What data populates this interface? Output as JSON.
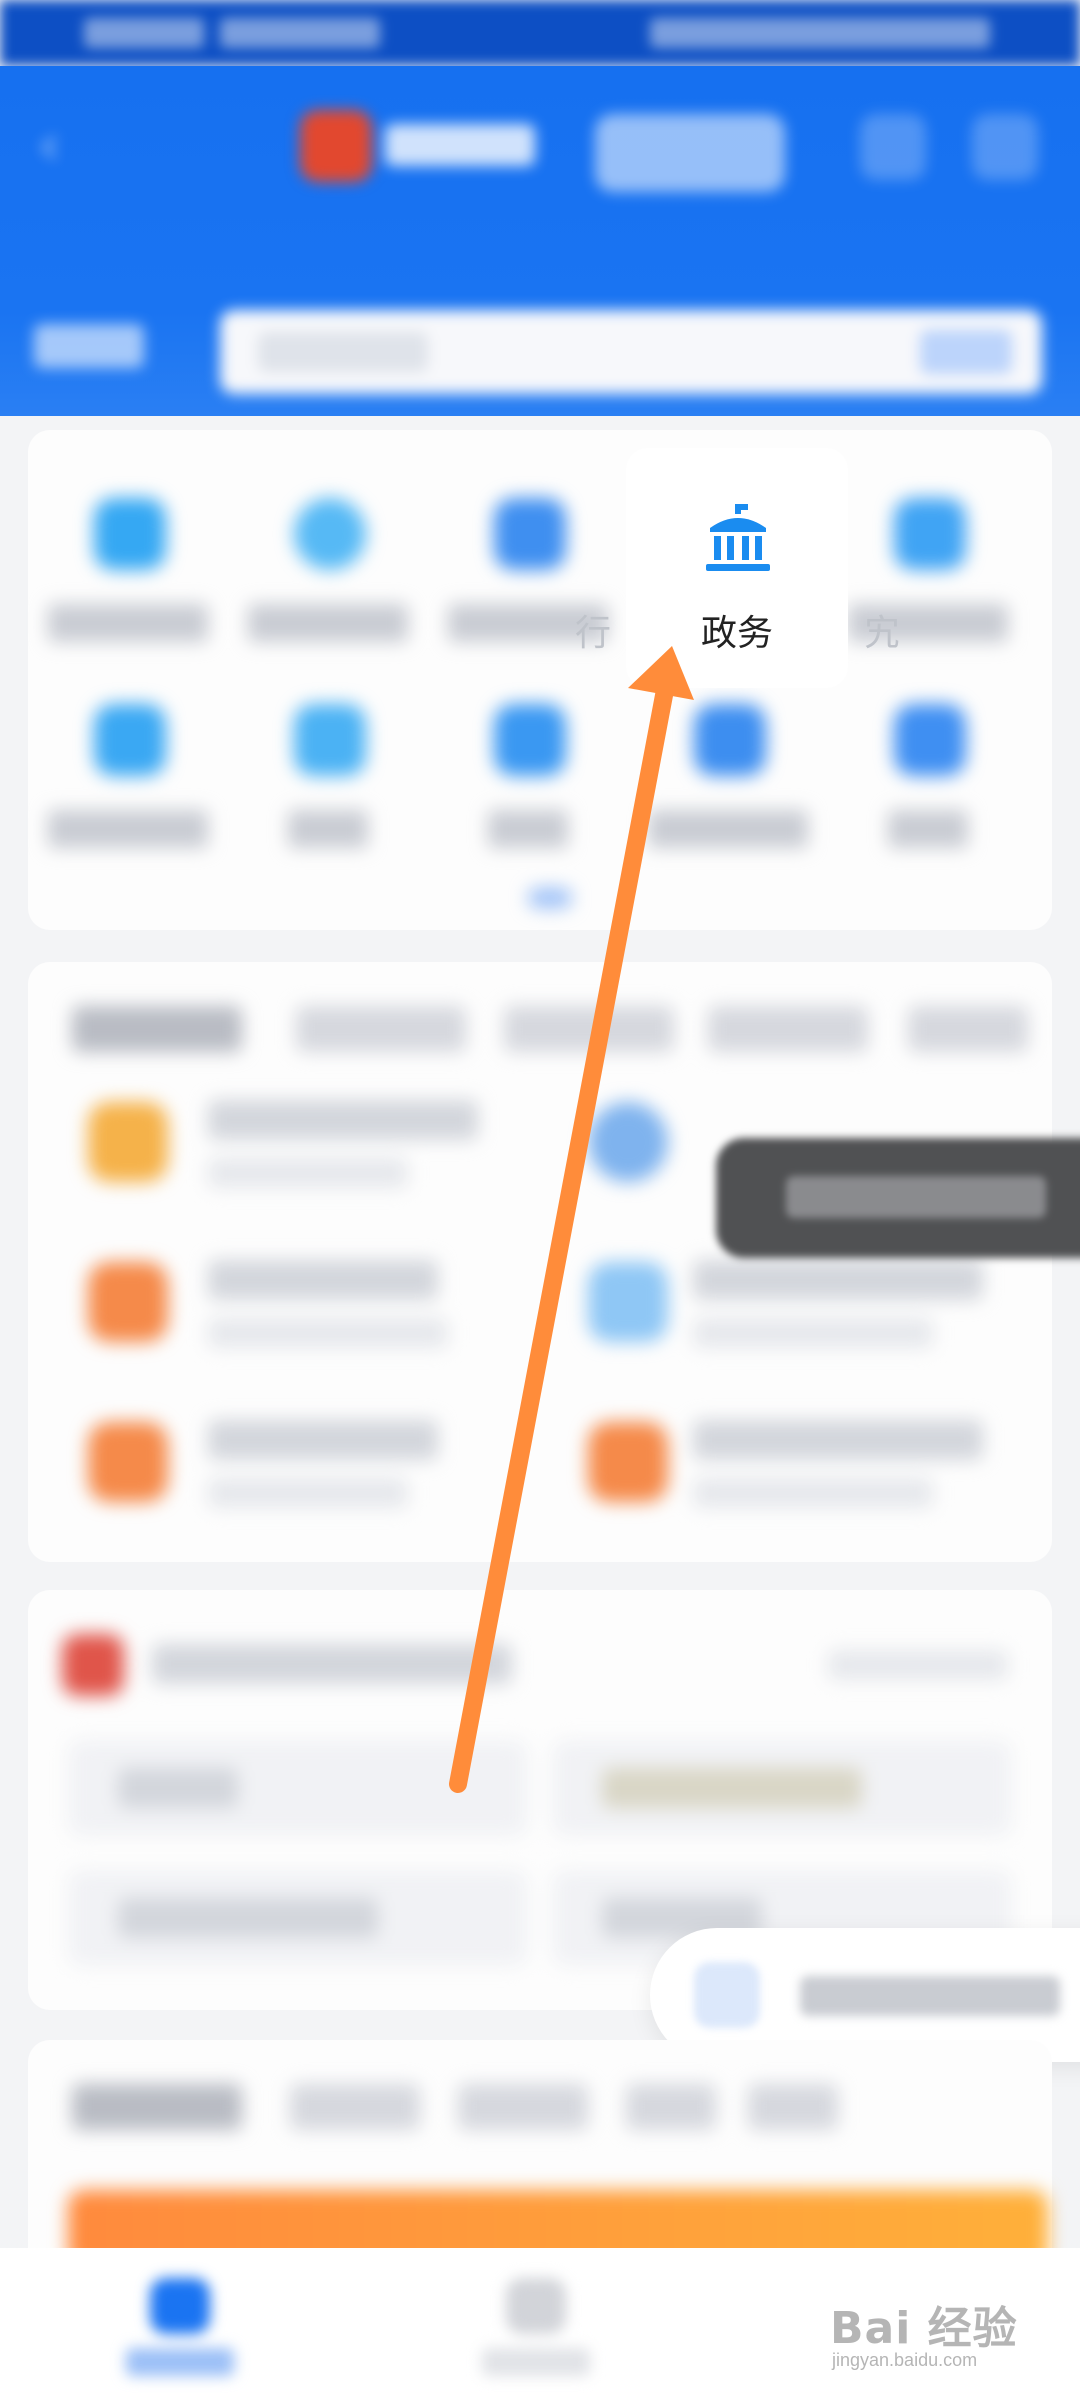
{
  "services": {
    "highlighted_label": "政务",
    "partial_left_label": "行",
    "partial_right_label": "宄"
  },
  "watermark": {
    "brand": "Bai 经验",
    "sub": "jingyan.baidu.com"
  },
  "colors": {
    "primary_blue": "#1a74f2",
    "annotation_arrow": "#ff8c3a",
    "gov_icon": "#1a8cf0"
  },
  "icons": {
    "gov": "government-building-icon",
    "back": "back-arrow-icon"
  }
}
